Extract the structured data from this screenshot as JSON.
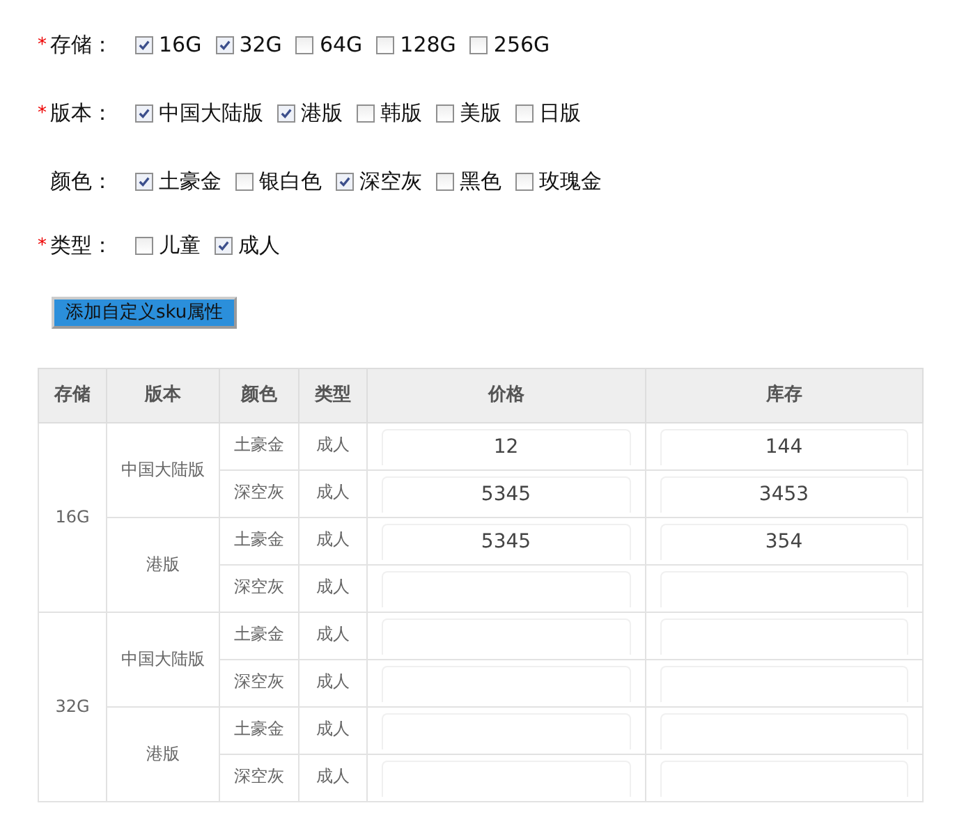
{
  "attributes": [
    {
      "label": "存储：",
      "required": true,
      "options": [
        {
          "label": "16G",
          "checked": true
        },
        {
          "label": "32G",
          "checked": true
        },
        {
          "label": "64G",
          "checked": false
        },
        {
          "label": "128G",
          "checked": false
        },
        {
          "label": "256G",
          "checked": false
        }
      ]
    },
    {
      "label": "版本：",
      "required": true,
      "options": [
        {
          "label": "中国大陆版",
          "checked": true
        },
        {
          "label": "港版",
          "checked": true
        },
        {
          "label": "韩版",
          "checked": false
        },
        {
          "label": "美版",
          "checked": false
        },
        {
          "label": "日版",
          "checked": false
        }
      ]
    },
    {
      "label": "颜色：",
      "required": false,
      "options": [
        {
          "label": "土豪金",
          "checked": true
        },
        {
          "label": "银白色",
          "checked": false
        },
        {
          "label": "深空灰",
          "checked": true
        },
        {
          "label": "黑色",
          "checked": false
        },
        {
          "label": "玫瑰金",
          "checked": false
        }
      ]
    },
    {
      "label": "类型：",
      "required": true,
      "options": [
        {
          "label": "儿童",
          "checked": false
        },
        {
          "label": "成人",
          "checked": true
        }
      ]
    }
  ],
  "required_mark": "*",
  "add_button": "添加自定义sku属性",
  "table": {
    "columns": [
      "存储",
      "版本",
      "颜色",
      "类型",
      "价格",
      "库存"
    ],
    "groups": [
      {
        "storage": "16G",
        "children": [
          {
            "edition": "中国大陆版",
            "children": [
              {
                "finish": "土豪金",
                "type": "成人",
                "price": "12",
                "stock": "144"
              },
              {
                "finish": "深空灰",
                "type": "成人",
                "price": "5345",
                "stock": "3453"
              }
            ]
          },
          {
            "edition": "港版",
            "children": [
              {
                "finish": "土豪金",
                "type": "成人",
                "price": "5345",
                "stock": "354"
              },
              {
                "finish": "深空灰",
                "type": "成人"
              }
            ]
          }
        ]
      },
      {
        "storage": "32G",
        "children": [
          {
            "edition": "中国大陆版",
            "children": [
              {
                "finish": "土豪金",
                "type": "成人"
              },
              {
                "finish": "深空灰",
                "type": "成人"
              }
            ]
          },
          {
            "edition": "港版",
            "children": [
              {
                "finish": "土豪金",
                "type": "成人"
              },
              {
                "finish": "深空灰",
                "type": "成人"
              }
            ]
          }
        ]
      }
    ]
  }
}
